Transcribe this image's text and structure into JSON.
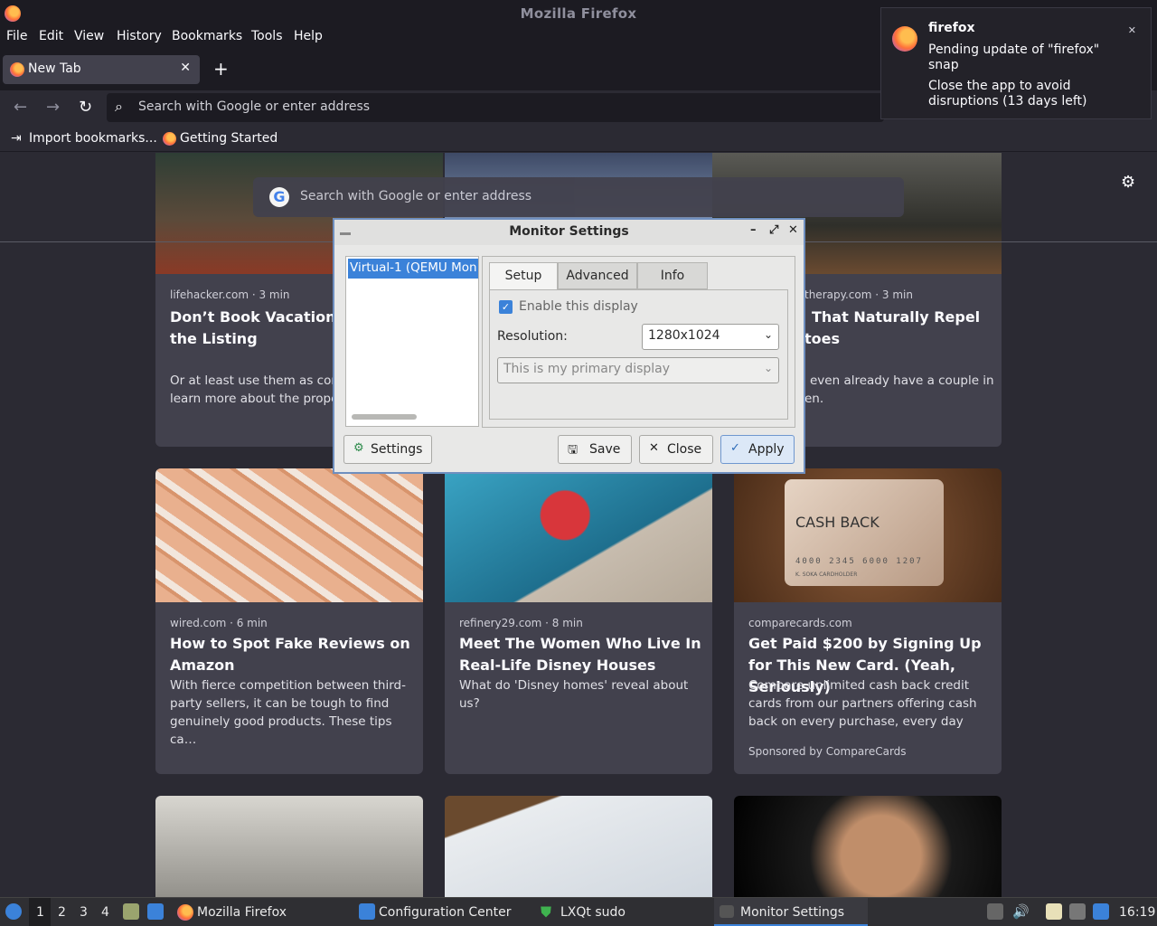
{
  "window": {
    "title": "Mozilla Firefox"
  },
  "menu": [
    "File",
    "Edit",
    "View",
    "History",
    "Bookmarks",
    "Tools",
    "Help"
  ],
  "tab": {
    "label": "New Tab"
  },
  "urlbar": {
    "placeholder": "Search with Google or enter address"
  },
  "bookmarks": [
    "Import bookmarks...",
    "Getting Started"
  ],
  "content_search": {
    "placeholder": "Search with Google or enter address"
  },
  "notification": {
    "app": "firefox",
    "line1": "Pending update of \"firefox\" snap",
    "line2": "Close the app to avoid disruptions (13 days left)"
  },
  "cards_row1": [
    {
      "source": "lifehacker.com · 3 min",
      "title": "Don’t Book Vacations With These Red-Flag W",
      "title2": "the Listing",
      "desc": "Or at least use them as conte",
      "desc2": "learn more about the proper"
    },
    {
      "source": "therapy.com · 3 min",
      "title": "That Naturally Repel",
      "title2": "toes",
      "desc": "even already have a couple in",
      "desc2": "en."
    }
  ],
  "cards_row2": [
    {
      "source": "wired.com · 6 min",
      "title": "How to Spot Fake Reviews on Amazon",
      "desc": "With fierce competition between third-party sellers, it can be tough to find genuinely good products. These tips ca…"
    },
    {
      "source": "refinery29.com · 8 min",
      "title": "Meet The Women Who Live In Real-Life Disney Houses",
      "desc": "What do 'Disney homes' reveal about us?"
    },
    {
      "source": "comparecards.com",
      "title": "Get Paid $200 by Signing Up for This New Card. (Yeah, Seriously)",
      "desc": "Compare unlimited cash back credit cards from our partners offering cash back on every purchase, every day",
      "sponsored": "Sponsored by CompareCards",
      "card_text": "CASH BACK",
      "card_number": "4000 2345 6000 1207",
      "card_holder": "K. SOKA CARDHOLDER"
    }
  ],
  "dialog": {
    "title": "Monitor Settings",
    "monitor": "Virtual-1 (QEMU Mon",
    "tabs": [
      "Setup",
      "Advanced",
      "Info"
    ],
    "enable_label": "Enable this display",
    "resolution_label": "Resolution:",
    "resolution_value": "1280x1024",
    "primary_value": "This is my primary display",
    "buttons": {
      "settings": "Settings",
      "save": "Save",
      "close": "Close",
      "apply": "Apply"
    }
  },
  "taskbar": {
    "desktops": [
      "1",
      "2",
      "3",
      "4"
    ],
    "tasks": [
      "Mozilla Firefox",
      "Configuration Center",
      "LXQt sudo",
      "Monitor Settings"
    ],
    "clock": "16:19"
  }
}
